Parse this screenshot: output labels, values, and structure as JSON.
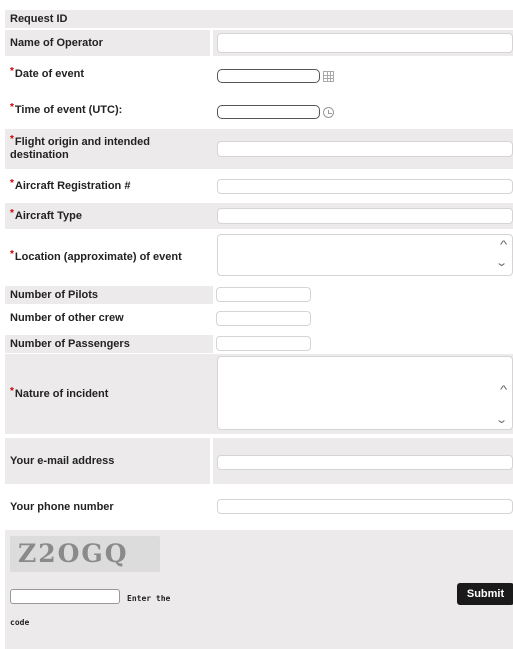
{
  "fields": {
    "request_id": {
      "label": "Request ID"
    },
    "operator": {
      "label": "Name of Operator"
    },
    "date": {
      "label": "Date of event",
      "required": "*"
    },
    "time": {
      "label": "Time of event (UTC):",
      "required": "*"
    },
    "flight": {
      "label": "Flight origin and intended destination",
      "required": "*"
    },
    "registration": {
      "label": "Aircraft Registration #",
      "required": "*"
    },
    "type": {
      "label": "Aircraft Type",
      "required": "*"
    },
    "location": {
      "label": "Location (approximate) of event",
      "required": "*"
    },
    "pilots": {
      "label": "Number of Pilots"
    },
    "crew": {
      "label": "Number of other crew"
    },
    "passengers": {
      "label": "Number of Passengers"
    },
    "nature": {
      "label": "Nature of incident",
      "required": "*"
    },
    "email": {
      "label": "Your e-mail address"
    },
    "phone": {
      "label": "Your phone number"
    }
  },
  "captcha": {
    "text": "Z2OGQ",
    "enter_label": "Enter the",
    "code_label": "code"
  },
  "submit_label": "Submit",
  "colors": {
    "row_bg": "#eceaea",
    "required_star": "#d00000",
    "button_bg": "#1a1a1a"
  },
  "icons": {
    "date": "calendar-icon",
    "time": "clock-icon"
  }
}
